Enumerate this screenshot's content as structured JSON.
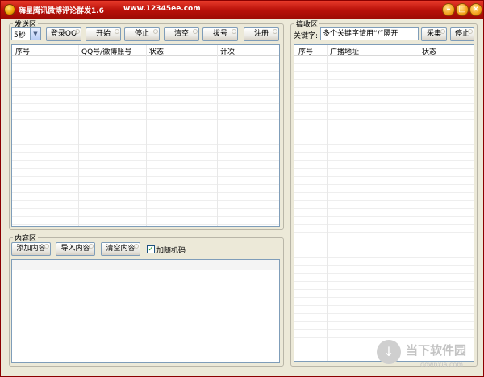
{
  "window": {
    "title": "嗨星腾讯微博评论群发1.6",
    "url_text": "www.12345ee.com",
    "controls": {
      "minimize": "–",
      "maximize": "□",
      "close": "×"
    }
  },
  "send_area": {
    "title": "发送区",
    "interval_select": {
      "value": "5秒",
      "arrow": "▼"
    },
    "buttons": {
      "login": "登录QQ",
      "start": "开始",
      "stop": "停止",
      "clear": "清空",
      "dial": "拔号",
      "register": "注册"
    },
    "table": {
      "columns": [
        "序号",
        "QQ号/微博账号",
        "状态",
        "计次"
      ],
      "rows": []
    }
  },
  "content_area": {
    "title": "内容区",
    "buttons": {
      "add": "添加内容",
      "import": "导入内容",
      "clear": "清空内容"
    },
    "random_code": {
      "label": "加随机码",
      "checked": true,
      "mark": "✓"
    }
  },
  "receive_area": {
    "title": "搞收区",
    "keyword_label": "关键字:",
    "keyword_value": "多个关键字请用“/”隔开",
    "buttons": {
      "collect": "采集",
      "stop": "停止"
    },
    "table": {
      "columns": [
        "序号",
        "广播地址",
        "状态"
      ],
      "rows": []
    }
  },
  "watermark": {
    "main": "当下软件园",
    "sub": "downxia.com",
    "icon": "↓"
  }
}
